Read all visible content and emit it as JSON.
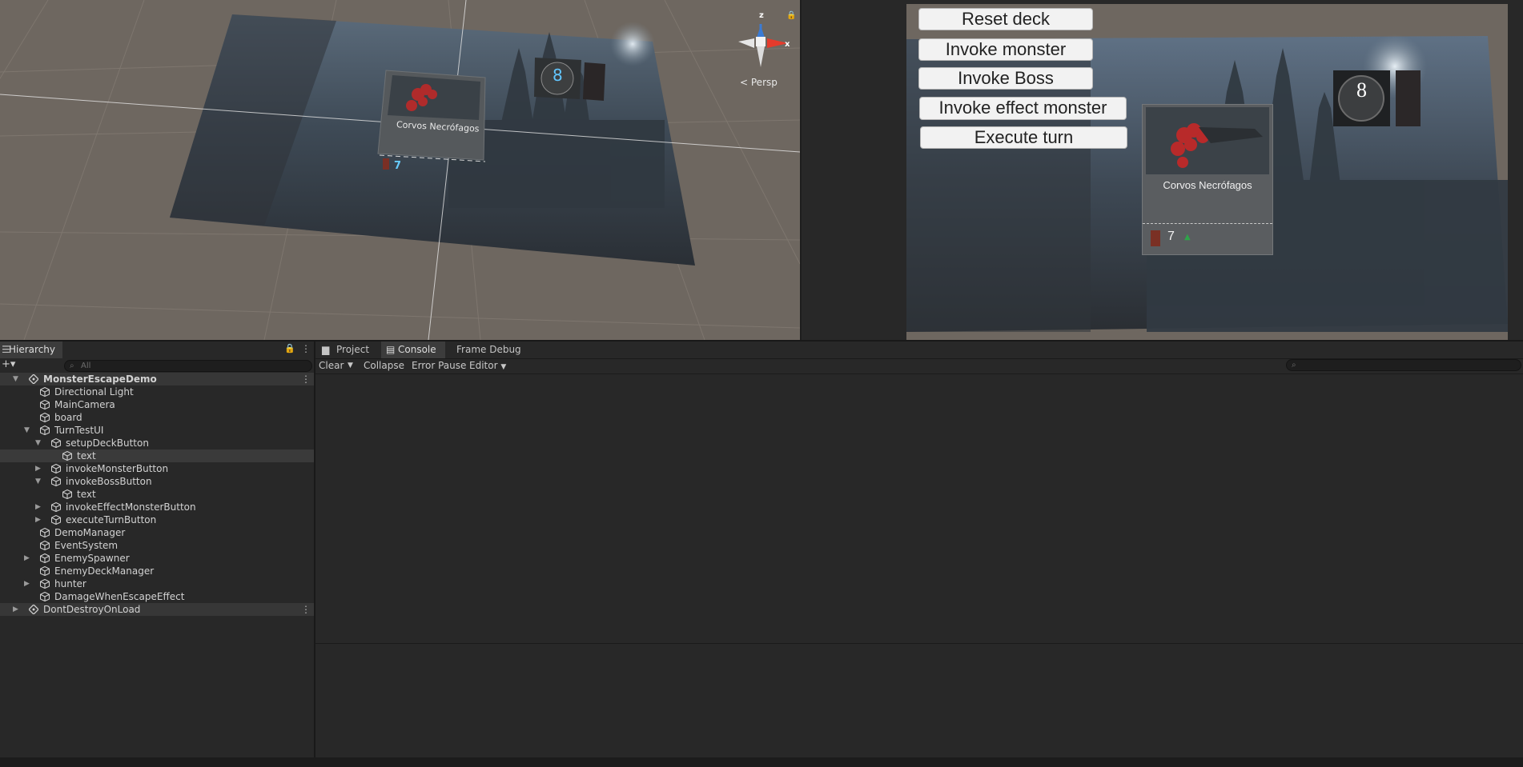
{
  "scene_view": {
    "camera_mode": "Persp",
    "gizmo_axes": [
      "z",
      "x"
    ],
    "card_name": "Corvos Necrófagos",
    "card_value": "7",
    "turn_badge": "8"
  },
  "game_view": {
    "buttons": {
      "reset_deck": "Reset deck",
      "invoke_monster": "Invoke monster",
      "invoke_boss": "Invoke Boss",
      "invoke_effect_monster": "Invoke effect monster",
      "execute_turn": "Execute turn"
    },
    "card_name": "Corvos Necrófagos",
    "card_value": "7",
    "turn_badge": "8"
  },
  "hierarchy": {
    "tab": "Hierarchy",
    "search_placeholder": "All",
    "items": [
      {
        "label": "MonsterEscapeDemo"
      },
      {
        "label": "Directional Light"
      },
      {
        "label": "MainCamera"
      },
      {
        "label": "board"
      },
      {
        "label": "TurnTestUI"
      },
      {
        "label": "setupDeckButton"
      },
      {
        "label": "text"
      },
      {
        "label": "invokeMonsterButton"
      },
      {
        "label": "invokeBossButton"
      },
      {
        "label": "text"
      },
      {
        "label": "invokeEffectMonsterButton"
      },
      {
        "label": "executeTurnButton"
      },
      {
        "label": "DemoManager"
      },
      {
        "label": "EventSystem"
      },
      {
        "label": "EnemySpawner"
      },
      {
        "label": "EnemyDeckManager"
      },
      {
        "label": "hunter"
      },
      {
        "label": "DamageWhenEscapeEffect"
      },
      {
        "label": "DontDestroyOnLoad"
      }
    ]
  },
  "console": {
    "tabs": [
      "Project",
      "Console",
      "Frame Debug"
    ],
    "toolbar": {
      "clear": "Clear",
      "collapse": "Collapse",
      "error_pause": "Error Pause",
      "editor": "Editor"
    }
  },
  "colors": {
    "editor_bg": "#282828",
    "scene_ground": "#6e6760",
    "button_face": "#f2f2f2",
    "gizmo_x": "#e53b2c",
    "gizmo_z": "#3a7bd5"
  }
}
